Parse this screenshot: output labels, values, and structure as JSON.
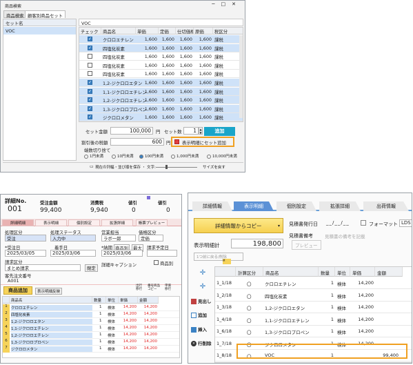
{
  "w1": {
    "title": "商品検索",
    "tabs": [
      "商品検索",
      "顧客別商品セット"
    ],
    "left_header": "セット名",
    "left_items": [
      "VOC"
    ],
    "right_header": "VOC",
    "cols": [
      "チェック",
      "商品名",
      "単価",
      "定価",
      "仕切価格",
      "原価",
      "税区分"
    ],
    "rows": [
      {
        "checked": true,
        "name": "クロロエチレン",
        "v": [
          "1,600",
          "1,600",
          "1,600",
          "1,600"
        ],
        "tax": "課税",
        "hl": true
      },
      {
        "checked": true,
        "name": "四塩化炭素",
        "v": [
          "1,600",
          "1,600",
          "1,600",
          "1,600"
        ],
        "tax": "課税",
        "hl": true
      },
      {
        "checked": false,
        "name": "四塩化炭素",
        "v": [
          "1,600",
          "1,600",
          "1,600",
          "1,600"
        ],
        "tax": "課税",
        "hl": false
      },
      {
        "checked": false,
        "name": "四塩化炭素",
        "v": [
          "1,600",
          "1,600",
          "1,600",
          "1,600"
        ],
        "tax": "課税",
        "hl": false
      },
      {
        "checked": false,
        "name": "四塩化炭素",
        "v": [
          "1,600",
          "1,600",
          "1,600",
          "1,600"
        ],
        "tax": "課税",
        "hl": false
      },
      {
        "checked": true,
        "name": "1,2-ジクロロエタン",
        "v": [
          "1,600",
          "1,600",
          "1,600",
          "1,600"
        ],
        "tax": "課税",
        "hl": true
      },
      {
        "checked": true,
        "name": "1,1-ジクロロエチレン",
        "v": [
          "1,600",
          "1,600",
          "1,600",
          "1,600"
        ],
        "tax": "課税",
        "hl": true
      },
      {
        "checked": true,
        "name": "1,2-ジクロロエチレン",
        "v": [
          "1,600",
          "1,600",
          "1,600",
          "1,600"
        ],
        "tax": "課税",
        "hl": true
      },
      {
        "checked": true,
        "name": "1,3-ジクロロプロペン",
        "v": [
          "1,600",
          "1,600",
          "1,600",
          "1,600"
        ],
        "tax": "課税",
        "hl": true
      },
      {
        "checked": true,
        "name": "ジクロロメタン",
        "v": [
          "1,600",
          "1,600",
          "1,600",
          "1,600"
        ],
        "tax": "課税",
        "hl": true
      }
    ],
    "total_label": "セット金額",
    "total_value": "100,000",
    "yen": "円",
    "count_label": "セット数",
    "count_value": "1",
    "add_label": "追加",
    "discount_label": "割引後の税額",
    "discount_value": "600",
    "show_label": "表示明細にセット追加",
    "round_label": "端数切り捨て",
    "round_opts": [
      "1円未満",
      "10円未満",
      "100円未満",
      "1,000円未満",
      "10,000円未満"
    ],
    "round_sel": 2,
    "footer": "現在の列幅・並び順を保存 ・ 文字:",
    "footer2": "サイズを戻す"
  },
  "w2": {
    "detail_no_label": "詳細No.",
    "detail_no": "001",
    "amount_label": "受注金額",
    "amount": "99,400",
    "tax_label": "消費税",
    "tax": "9,940",
    "discount_label": "値引",
    "discount": "0",
    "rebate_label": "値引",
    "rebate": "0",
    "tabs": [
      "詳細明細",
      "表示明細",
      "個別設定",
      "拡張詳細",
      "帳票プレビュー"
    ],
    "f_kubun_label": "処理区分",
    "f_kubun": "受注",
    "f_status_label": "処理ステータス",
    "f_status": "入力中",
    "f_eigyo_label": "営業担当",
    "f_eigyo": "ラボ一郎",
    "f_kakaku_label": "価格区分",
    "f_kakaku": "定価",
    "f_date1_label": "*受注日",
    "f_date1": "2025/03/05",
    "f_date2_label": "着手日",
    "f_date2": "2025/03/06",
    "f_date3_label": "*納期",
    "f_date3": "2025/03/06",
    "f_item_label": "商品別",
    "f_max_label": "最大",
    "f_yotei_label": "請求予定日",
    "f_seikyu_label": "請求区分",
    "f_seikyu": "まとめ請求",
    "f_close": "閉定",
    "f_caption": "詳細キャプション",
    "f_goods_label": "商品別",
    "f_kyaku_label": "客先注文番号",
    "f_kyaku": "A001",
    "add_btn": "商品追加",
    "reflect_btn": "表示明細反映",
    "tool_labels": [
      "出行 移行",
      "番号商品 コピー",
      "単価 移行"
    ],
    "grid_cols": [
      "",
      "商品名",
      "数量",
      "単位",
      "単価",
      "金額"
    ],
    "grid_rows": [
      {
        "n": "1",
        "name": "クロロエチレン",
        "q": "1",
        "u": "検体",
        "p": "14,200",
        "a": "14,200"
      },
      {
        "n": "2",
        "name": "四塩化炭素",
        "q": "1",
        "u": "検体",
        "p": "14,200",
        "a": "14,200"
      },
      {
        "n": "3",
        "name": "1,2-ジクロロエタン",
        "q": "1",
        "u": "検体",
        "p": "14,200",
        "a": "14,200"
      },
      {
        "n": "4",
        "name": "1,1-ジクロロエチレン",
        "q": "1",
        "u": "検体",
        "p": "14,200",
        "a": "14,200"
      },
      {
        "n": "5",
        "name": "1,2-ジクロロエチレン",
        "q": "1",
        "u": "検体",
        "p": "14,200",
        "a": "14,200"
      },
      {
        "n": "6",
        "name": "1,3-ジクロロプロペン",
        "q": "1",
        "u": "検体",
        "p": "14,200",
        "a": "14,200"
      },
      {
        "n": "7",
        "name": "ジクロロメタン",
        "q": "1",
        "u": "検体",
        "p": "14,200",
        "a": "14,200"
      }
    ]
  },
  "w3": {
    "tabs": [
      "詳細情報",
      "表示明細",
      "個別設定",
      "拡張詳細",
      "出荷情報"
    ],
    "copy_btn": "詳細情報からコピー",
    "issue_label": "見積書発行日",
    "issue_value": "__/__/__",
    "format_label": "フォーマット",
    "format_value": "LDS",
    "note_label": "見積書備考",
    "note_placeholder": "見積書の備考を記載",
    "preview_btn": "プレビュー",
    "total_label": "表示明細計",
    "total_value": "198,800",
    "sub_btn": "1つ前に戻る/削除",
    "side_labels": [
      "見出し",
      "追加",
      "挿入",
      "行削除"
    ],
    "cols": [
      "",
      "計算区分",
      "商品名",
      "数量",
      "単位",
      "単価",
      "金額"
    ],
    "rows": [
      {
        "id": "1_1/18",
        "c": "〇",
        "name": "クロロエチレン",
        "q": "1",
        "u": "検体",
        "p": "14,200",
        "a": ""
      },
      {
        "id": "1_2/18",
        "c": "〇",
        "name": "四塩化炭素",
        "q": "1",
        "u": "検体",
        "p": "14,200",
        "a": ""
      },
      {
        "id": "1_3/18",
        "c": "〇",
        "name": "1,2-ジクロロエタン",
        "q": "1",
        "u": "検体",
        "p": "14,200",
        "a": ""
      },
      {
        "id": "1_4/18",
        "c": "〇",
        "name": "1,1-ジクロロエチレン",
        "q": "1",
        "u": "検体",
        "p": "14,200",
        "a": ""
      },
      {
        "id": "1_6/18",
        "c": "〇",
        "name": "1,3-ジクロロプロペン",
        "q": "1",
        "u": "検体",
        "p": "14,200",
        "a": ""
      },
      {
        "id": "1_7/18",
        "c": "〇",
        "name": "ジクロロメタン",
        "q": "1",
        "u": "検体",
        "p": "14,200",
        "a": ""
      },
      {
        "id": "1_8/18",
        "c": "〇",
        "name": "VOC",
        "q": "1",
        "u": "",
        "p": "",
        "a": "99,400"
      }
    ]
  }
}
